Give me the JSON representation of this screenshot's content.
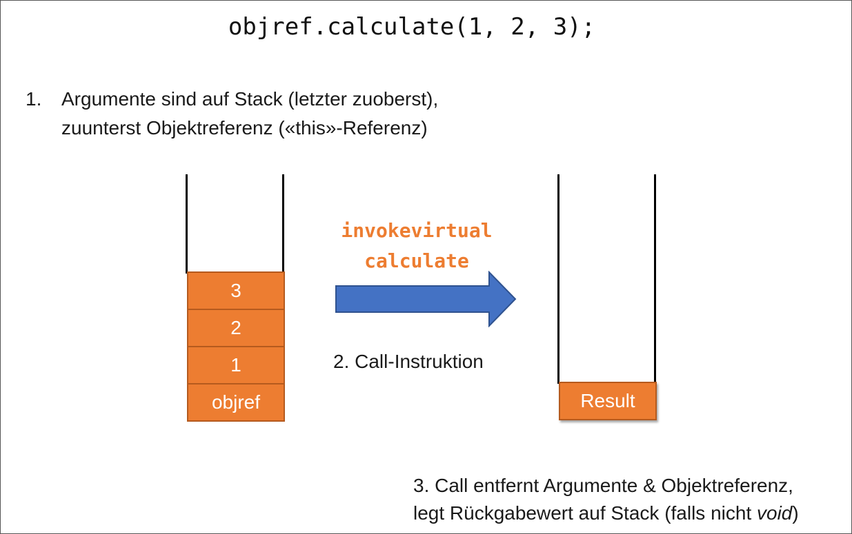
{
  "code_line": "objref.calculate(1, 2, 3);",
  "step1": {
    "number": "1.",
    "line1": "Argumente sind auf Stack (letzter zuoberst),",
    "line2": "zuunterst Objektreferenz («this»-Referenz)"
  },
  "stack_before": [
    "3",
    "2",
    "1",
    "objref"
  ],
  "instruction": {
    "opcode": "invokevirtual",
    "method": "calculate"
  },
  "step2": "2. Call-Instruktion",
  "stack_after": [
    "Result"
  ],
  "step3": {
    "line1": "3. Call entfernt Argumente & Objektreferenz,",
    "line2_prefix": "legt Rückgabewert auf Stack (falls nicht ",
    "line2_italic": "void",
    "line2_suffix": ")"
  },
  "colors": {
    "cell_fill": "#ed7d31",
    "cell_border": "#b55a1e",
    "instruction_text": "#ed7d31",
    "arrow_fill": "#4472c4",
    "arrow_border": "#2f528f"
  },
  "icons": [
    "right-arrow-icon"
  ]
}
